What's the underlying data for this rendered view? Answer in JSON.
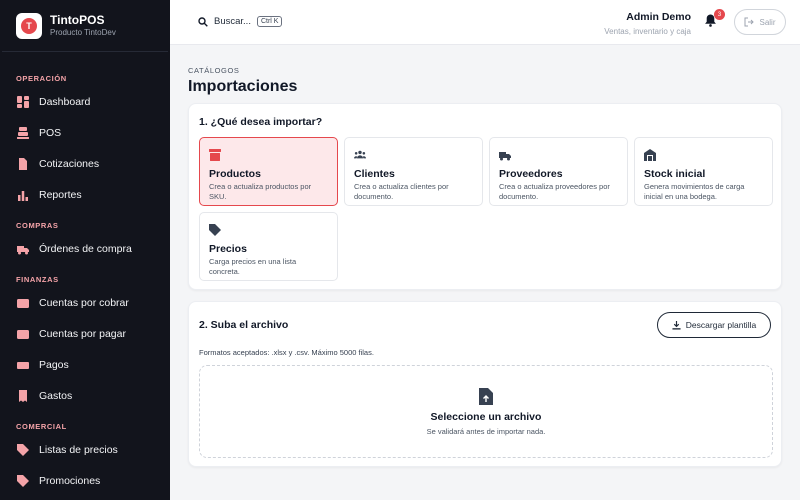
{
  "brand": {
    "name": "TintoPOS",
    "subtitle": "Producto TintoDev",
    "logo_letter": "T"
  },
  "sidebar": {
    "sections": [
      {
        "title": "OPERACIÓN",
        "items": [
          {
            "label": "Dashboard",
            "icon": "dashboard-icon"
          },
          {
            "label": "POS",
            "icon": "cash-register-icon"
          },
          {
            "label": "Cotizaciones",
            "icon": "document-icon"
          },
          {
            "label": "Reportes",
            "icon": "bar-chart-icon"
          }
        ]
      },
      {
        "title": "COMPRAS",
        "items": [
          {
            "label": "Órdenes de compra",
            "icon": "truck-icon"
          }
        ]
      },
      {
        "title": "FINANZAS",
        "items": [
          {
            "label": "Cuentas por cobrar",
            "icon": "wallet-icon"
          },
          {
            "label": "Cuentas por pagar",
            "icon": "wallet-icon"
          },
          {
            "label": "Pagos",
            "icon": "money-icon"
          },
          {
            "label": "Gastos",
            "icon": "receipt-icon"
          }
        ]
      },
      {
        "title": "COMERCIAL",
        "items": [
          {
            "label": "Listas de precios",
            "icon": "tag-icon"
          },
          {
            "label": "Promociones",
            "icon": "tag-icon"
          }
        ]
      }
    ]
  },
  "topbar": {
    "search_label": "Buscar...",
    "search_shortcut": "Ctrl K",
    "user_name": "Admin Demo",
    "user_role": "Ventas, inventario y caja",
    "notification_count": "3",
    "logout_label": "Salir"
  },
  "page": {
    "breadcrumb": "CATÁLOGOS",
    "title": "Importaciones"
  },
  "step1": {
    "title": "1. ¿Qué desea importar?",
    "options": [
      {
        "name": "Productos",
        "desc": "Crea o actualiza productos por SKU.",
        "selected": true
      },
      {
        "name": "Clientes",
        "desc": "Crea o actualiza clientes por documento."
      },
      {
        "name": "Proveedores",
        "desc": "Crea o actualiza proveedores por documento."
      },
      {
        "name": "Stock inicial",
        "desc": "Genera movimientos de carga inicial en una bodega."
      },
      {
        "name": "Precios",
        "desc": "Carga precios en una lista concreta."
      }
    ]
  },
  "step2": {
    "title": "2. Suba el archivo",
    "download_label": "Descargar plantilla",
    "formats": "Formatos aceptados: .xlsx y .csv. Máximo 5000 filas.",
    "drop_title": "Seleccione un archivo",
    "drop_subtitle": "Se validará antes de importar nada."
  },
  "colors": {
    "accent": "#e5484d",
    "sidebar_bg": "#12141c",
    "section_title": "#f4a3a8"
  }
}
